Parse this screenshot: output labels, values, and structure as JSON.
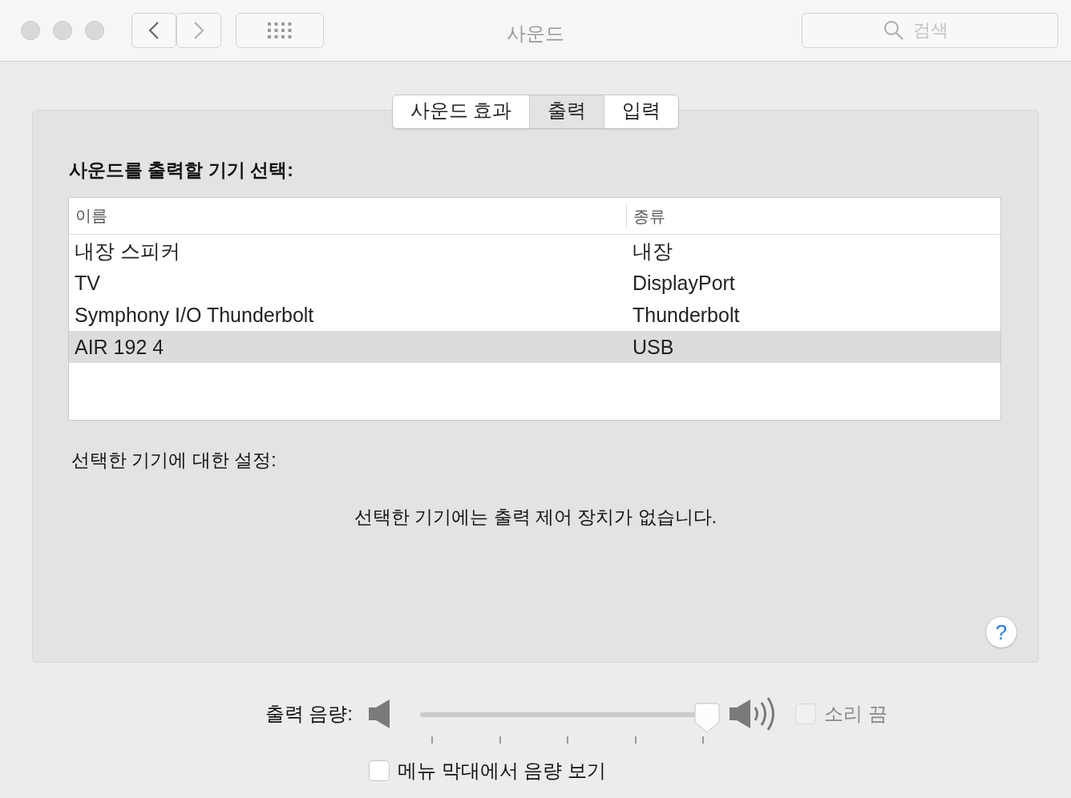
{
  "window": {
    "title": "사운드",
    "search": {
      "placeholder": "검색"
    }
  },
  "tabs": [
    {
      "label": "사운드 효과",
      "selected": false
    },
    {
      "label": "출력",
      "selected": true
    },
    {
      "label": "입력",
      "selected": false
    }
  ],
  "device_heading": "사운드를 출력할 기기 선택:",
  "table": {
    "columns": [
      "이름",
      "종류"
    ],
    "rows": [
      {
        "cells": [
          "내장 스피커",
          "내장"
        ],
        "selected": false
      },
      {
        "cells": [
          "TV",
          "DisplayPort"
        ],
        "selected": false
      },
      {
        "cells": [
          "Symphony I/O Thunderbolt",
          "Thunderbolt"
        ],
        "selected": false
      },
      {
        "cells": [
          "AIR 192 4",
          "USB"
        ],
        "selected": true
      }
    ]
  },
  "settings_heading": "선택한 기기에 대한 설정:",
  "settings_message": "선택한 기기에는 출력 제어 장치가 없습니다.",
  "help_button": "?",
  "volume": {
    "label": "출력 음량:",
    "level": 1,
    "mute": {
      "label": "소리 끔",
      "checked": false,
      "disabled": true
    }
  },
  "menu_bar_option": {
    "label": "메뉴 막대에서 음량 보기",
    "checked": false
  }
}
